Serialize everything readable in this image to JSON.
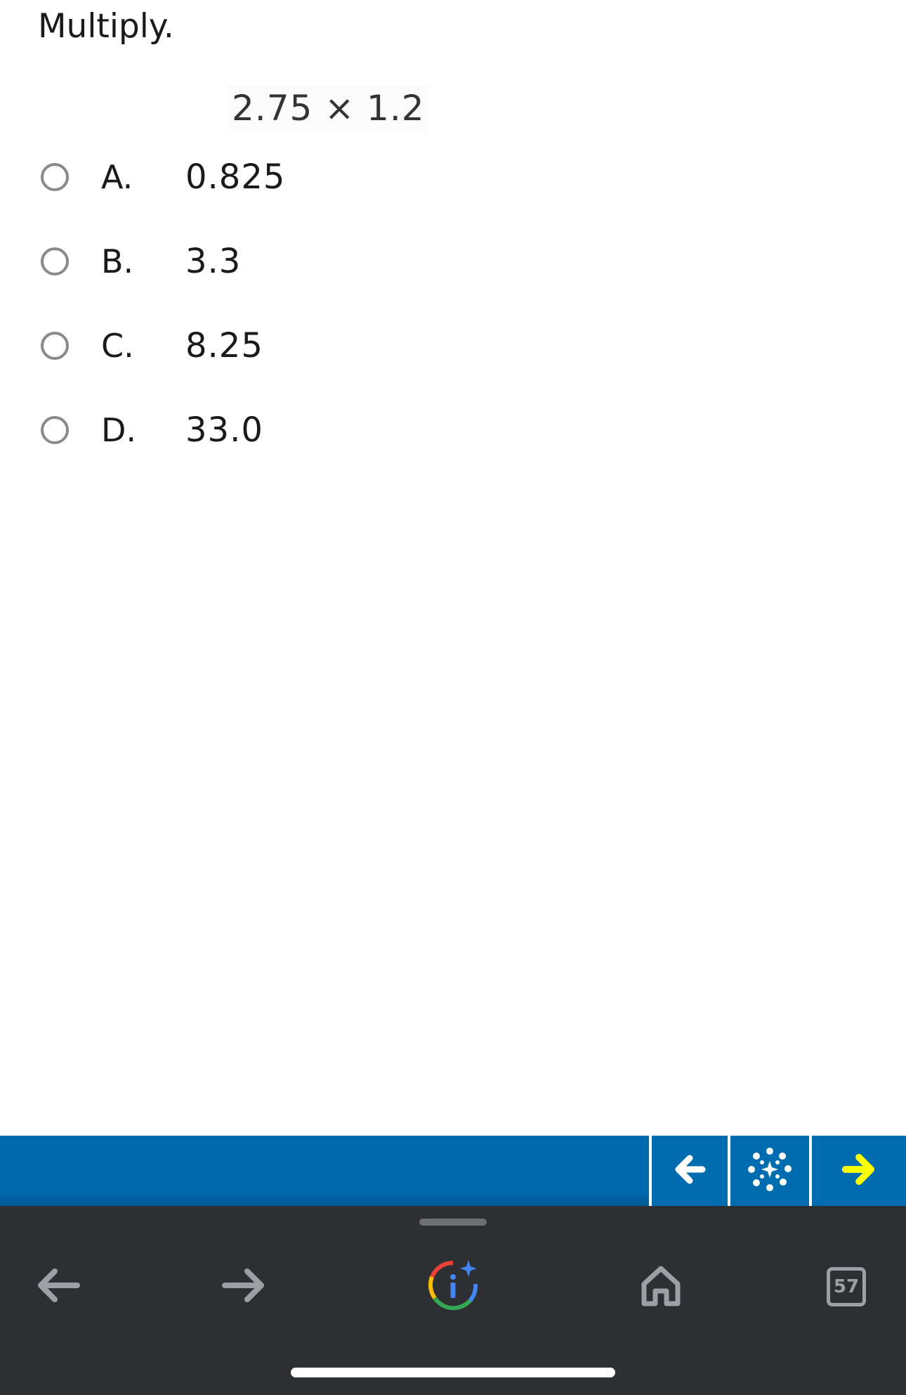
{
  "question": {
    "prompt": "Multiply.",
    "expression": "2.75 × 1.2"
  },
  "choices": [
    {
      "letter": "A.",
      "value": "0.825"
    },
    {
      "letter": "B.",
      "value": "3.3"
    },
    {
      "letter": "C.",
      "value": "8.25"
    },
    {
      "letter": "D.",
      "value": "33.0"
    }
  ],
  "toolbar": {
    "background": "#0068ad",
    "buttons": [
      "back-arrow-icon",
      "settings-wheel-icon",
      "forward-arrow-icon"
    ],
    "forward_arrow_color": "#ffff00"
  },
  "browser": {
    "tab_count": "57",
    "buttons": [
      "back-icon",
      "forward-icon",
      "google-lens-icon",
      "home-icon",
      "tabs-icon"
    ]
  }
}
